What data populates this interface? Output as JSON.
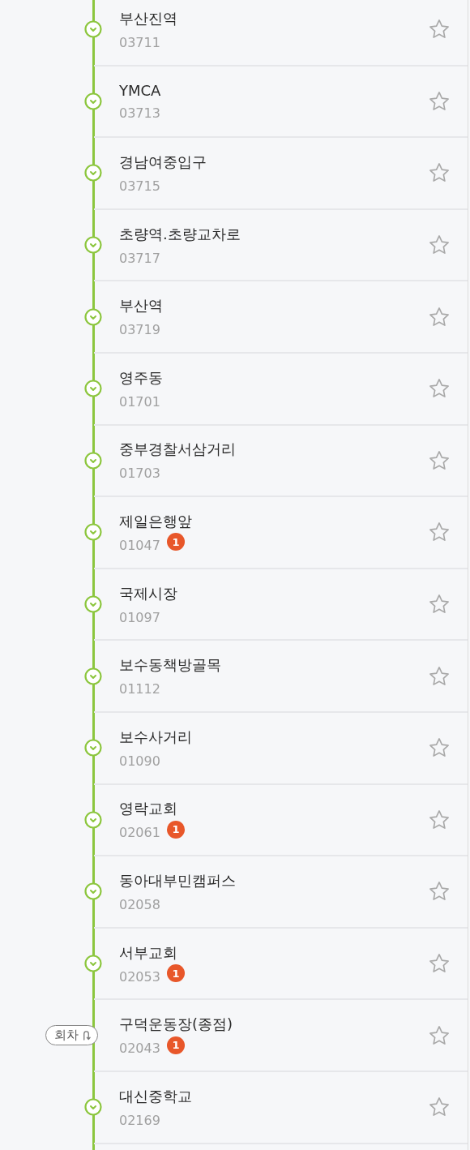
{
  "stops": [
    {
      "name": "부산진역",
      "code": "03711",
      "favorite": false
    },
    {
      "name": "YMCA",
      "code": "03713",
      "favorite": false
    },
    {
      "name": "경남여중입구",
      "code": "03715",
      "favorite": false
    },
    {
      "name": "초량역.초량교차로",
      "code": "03717",
      "favorite": false
    },
    {
      "name": "부산역",
      "code": "03719",
      "favorite": false
    },
    {
      "name": "영주동",
      "code": "01701",
      "favorite": false
    },
    {
      "name": "중부경찰서삼거리",
      "code": "01703",
      "favorite": false
    },
    {
      "name": "제일은행앞",
      "code": "01047",
      "badge": "1",
      "favorite": false
    },
    {
      "name": "국제시장",
      "code": "01097",
      "favorite": false
    },
    {
      "name": "보수동책방골목",
      "code": "01112",
      "favorite": false
    },
    {
      "name": "보수사거리",
      "code": "01090",
      "favorite": false
    },
    {
      "name": "영락교회",
      "code": "02061",
      "badge": "1",
      "favorite": false
    },
    {
      "name": "동아대부민캠퍼스",
      "code": "02058",
      "favorite": false
    },
    {
      "name": "서부교회",
      "code": "02053",
      "badge": "1",
      "favorite": false
    },
    {
      "name": "구덕운동장(종점)",
      "code": "02043",
      "badge": "1",
      "favorite": false,
      "turnaround": "회차"
    },
    {
      "name": "대신중학교",
      "code": "02169",
      "favorite": false
    }
  ]
}
